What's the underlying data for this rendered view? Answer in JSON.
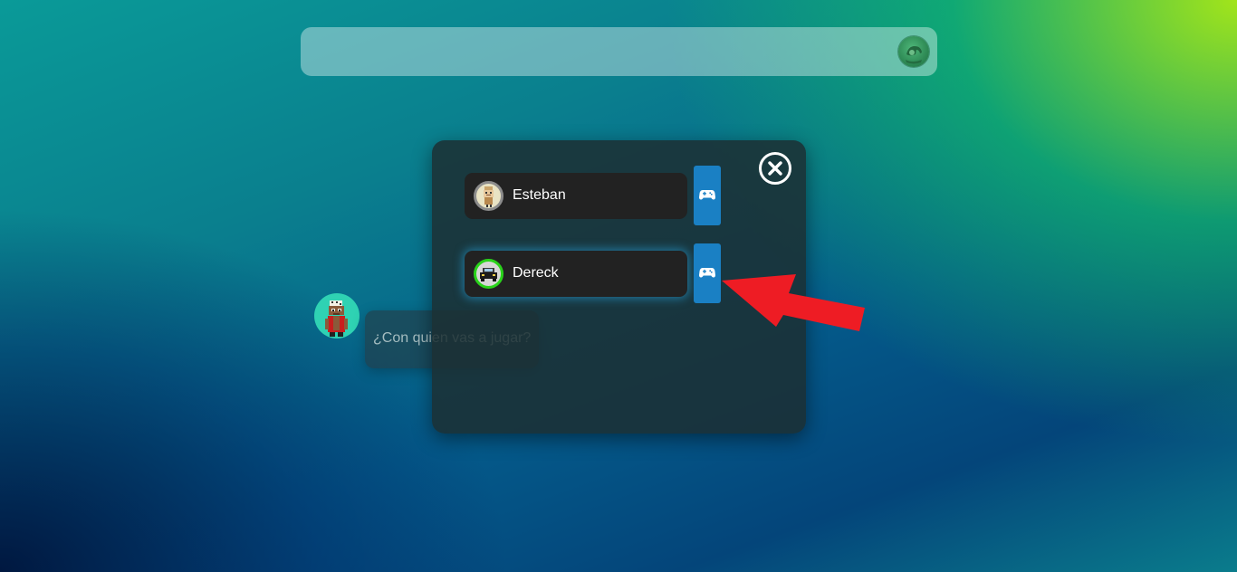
{
  "top_bar": {
    "avatar_icon": "cartoon-character-avatar"
  },
  "assistant": {
    "avatar_icon": "pixel-character-avatar",
    "prompt": "¿Con quien vas a jugar?"
  },
  "player_dialog": {
    "close_icon": "close-circle-icon",
    "players": [
      {
        "name": "Esteban",
        "avatar_icon": "pixel-character-avatar",
        "selected": false,
        "action_icon": "gamepad-icon"
      },
      {
        "name": "Dereck",
        "avatar_icon": "car-avatar",
        "selected": true,
        "action_icon": "gamepad-icon"
      }
    ]
  },
  "annotation": {
    "arrow_color": "#ee1c24"
  },
  "colors": {
    "play_button": "#1a80c4",
    "player_card": "#222222",
    "online_ring": "#29d31a"
  }
}
